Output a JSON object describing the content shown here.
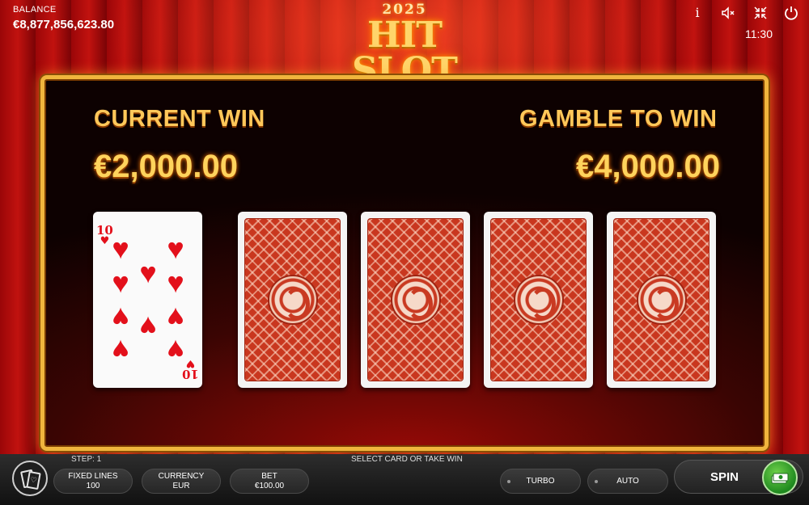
{
  "header": {
    "balance_label": "BALANCE",
    "balance_value": "€8,877,856,623.80",
    "logo_year": "2025",
    "logo_title": "HIT SLOT",
    "clock": "11:30",
    "icons": [
      "info-icon",
      "sound-off-icon",
      "fullscreen-icon",
      "power-icon"
    ]
  },
  "gamble": {
    "current_win_label": "CURRENT WIN",
    "current_win_value": "€2,000.00",
    "gamble_to_win_label": "GAMBLE TO WIN",
    "gamble_to_win_value": "€4,000.00",
    "dealer_card": {
      "rank": "10",
      "suit": "hearts",
      "suit_glyph": "♥"
    },
    "face_down_cards": 4
  },
  "bottom": {
    "step_text": "STEP: 1",
    "message": "SELECT CARD OR TAKE WIN",
    "fixed_lines_label": "FIXED LINES",
    "fixed_lines_value": "100",
    "currency_label": "CURRENCY",
    "currency_value": "EUR",
    "bet_label": "BET",
    "bet_value": "€100.00",
    "turbo_label": "TURBO",
    "auto_label": "AUTO",
    "spin_label": "SPIN"
  },
  "colors": {
    "accent_gold": "#ffc85a",
    "panel_border": "#f0b53d",
    "card_back": "#c9371f",
    "heart_red": "#e3101b",
    "collect_green": "#1f8a1f"
  }
}
